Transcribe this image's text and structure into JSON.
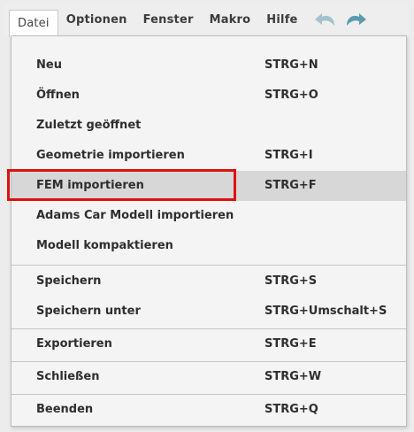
{
  "menubar": {
    "items": [
      {
        "label": "Datei",
        "active": true
      },
      {
        "label": "Optionen"
      },
      {
        "label": "Fenster"
      },
      {
        "label": "Makro"
      },
      {
        "label": "Hilfe"
      }
    ],
    "icons": [
      "undo-icon",
      "redo-icon"
    ]
  },
  "menu": {
    "items": [
      {
        "label": "Neu",
        "shortcut": "STRG+N"
      },
      {
        "label": "Öffnen",
        "shortcut": "STRG+O"
      },
      {
        "label": "Zuletzt geöffnet",
        "shortcut": ""
      },
      {
        "label": "Geometrie importieren",
        "shortcut": "STRG+I"
      },
      {
        "label": "FEM importieren",
        "shortcut": "STRG+F",
        "highlighted": true
      },
      {
        "label": "Adams Car Modell importieren",
        "shortcut": ""
      },
      {
        "label": "Modell kompaktieren",
        "shortcut": ""
      },
      {
        "label": "Speichern",
        "shortcut": "STRG+S"
      },
      {
        "label": "Speichern unter",
        "shortcut": "STRG+Umschalt+S"
      },
      {
        "label": "Exportieren",
        "shortcut": "STRG+E"
      },
      {
        "label": "Schließen",
        "shortcut": "STRG+W"
      },
      {
        "label": "Beenden",
        "shortcut": "STRG+Q"
      }
    ]
  },
  "colors": {
    "highlight_row": "#d7d7d7",
    "annotation_box": "#e01010",
    "icon_color": "#5a9bb0"
  }
}
